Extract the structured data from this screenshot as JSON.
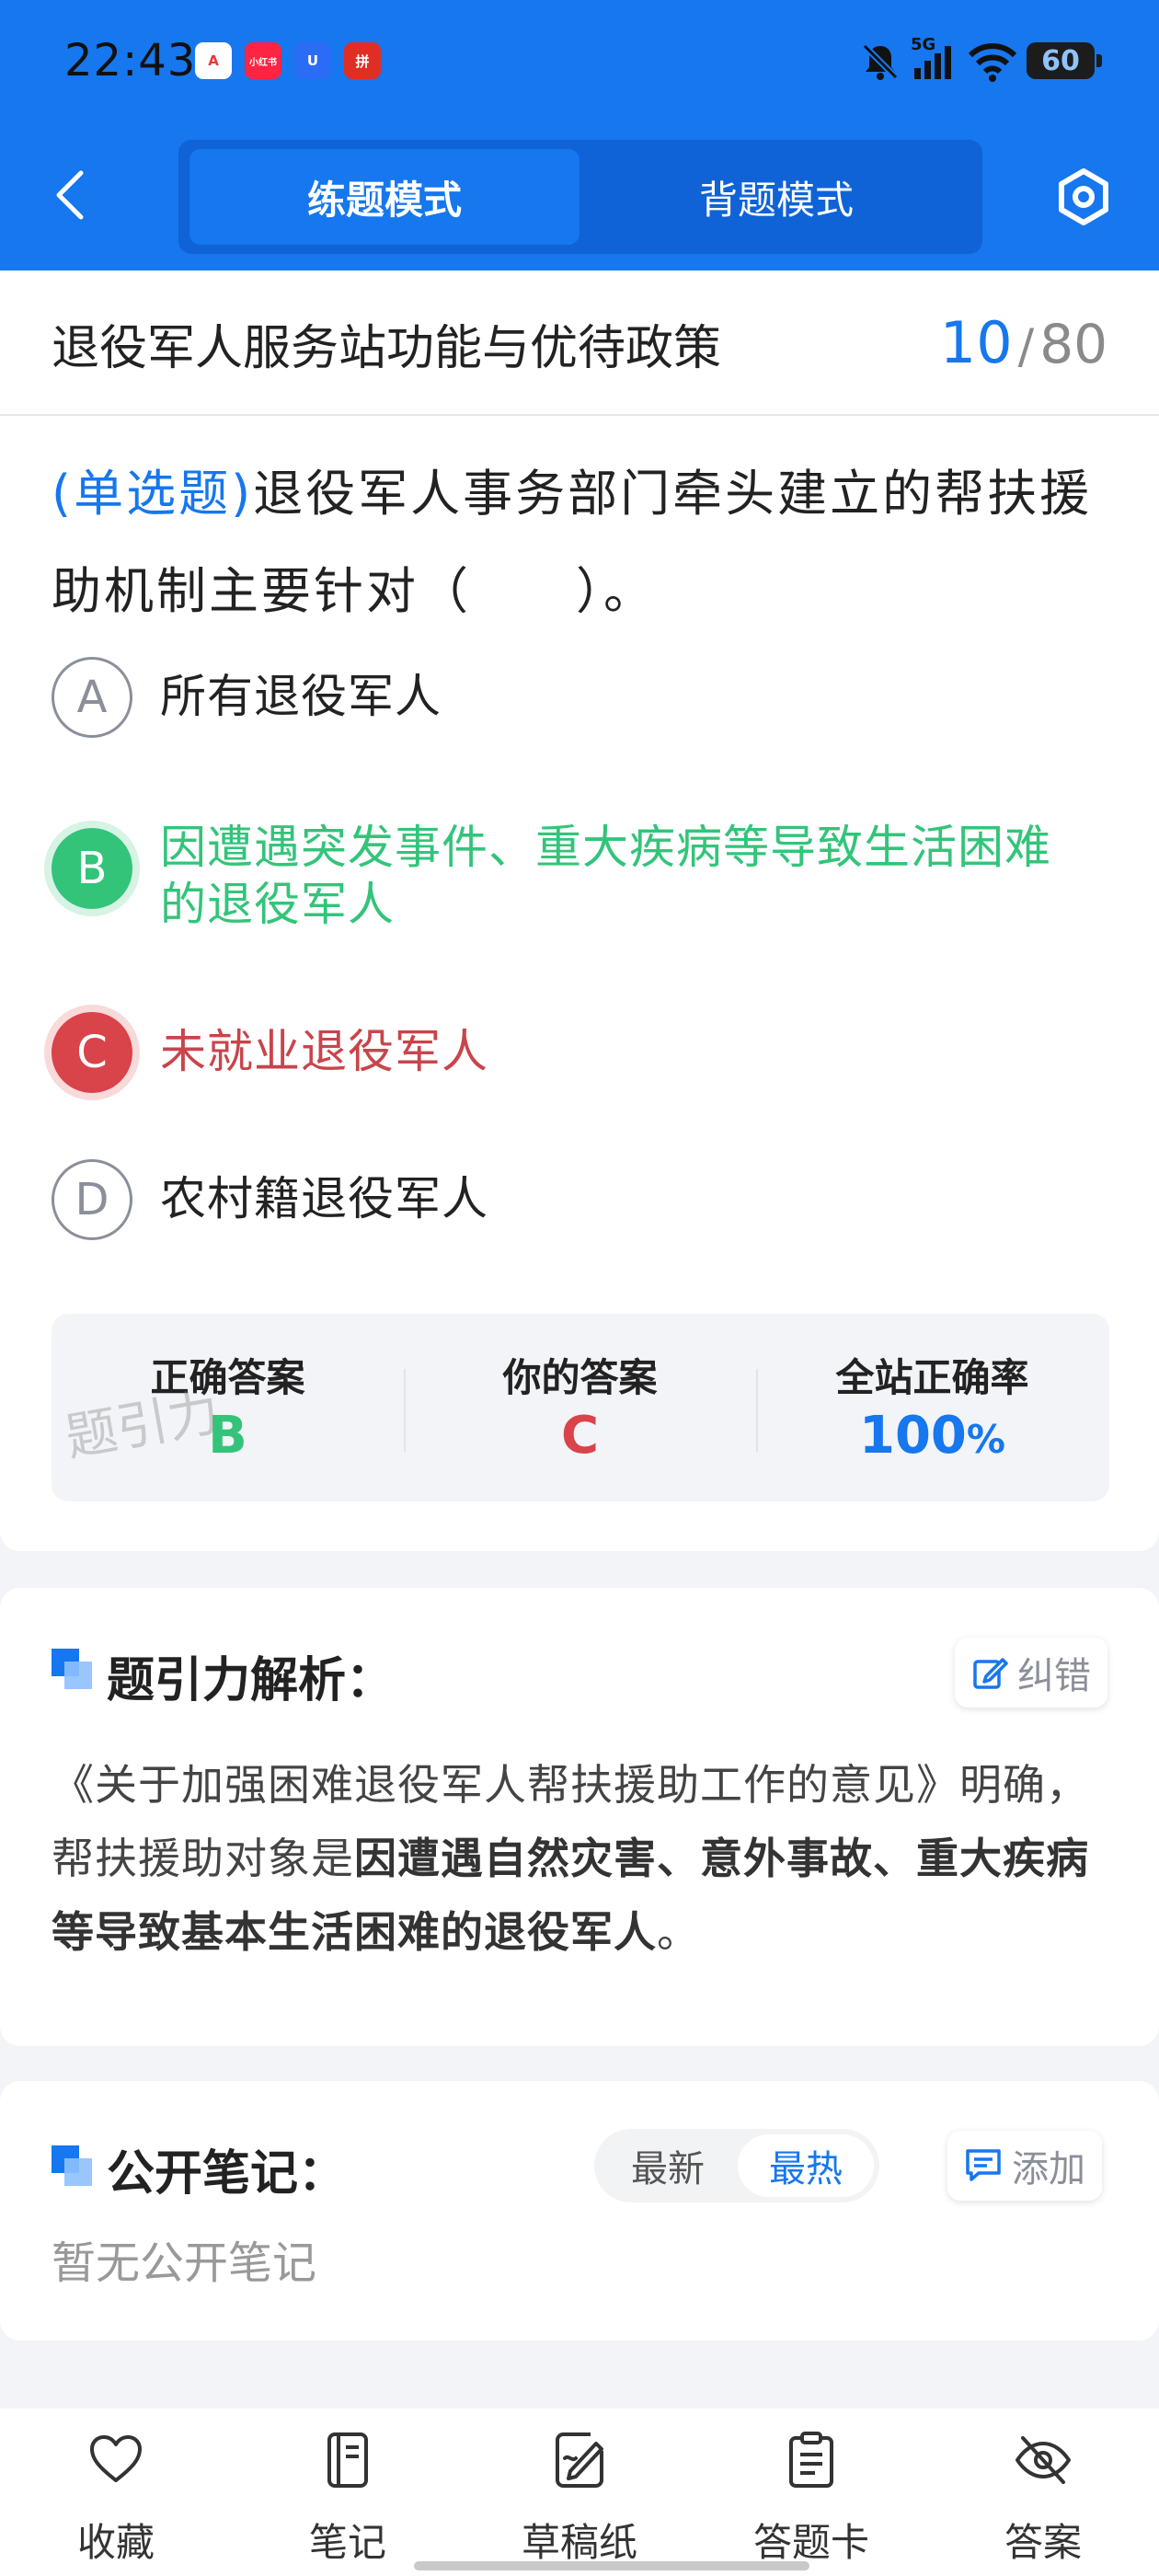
{
  "status_bar": {
    "time": "22:43",
    "network": "5G",
    "battery": "60",
    "app_icons": [
      "app-a-icon",
      "xiaohongshu-icon",
      "u-app-icon",
      "pinduoduo-icon"
    ],
    "app_icon_labels": [
      "A",
      "小红书",
      "U",
      "拼"
    ],
    "app_icon_colors": [
      "#e63a3a",
      "#ff2442",
      "#2a6cf5",
      "#e02e24"
    ]
  },
  "header": {
    "mode_practice": "练题模式",
    "mode_recite": "背题模式",
    "active_mode": "练题模式"
  },
  "question_header": {
    "section_title": "退役军人服务站功能与优待政策",
    "current": "10",
    "separator": "/",
    "total": "80"
  },
  "question": {
    "type": "(单选题)",
    "stem": "退役军人事务部门牵头建立的帮扶援助机制主要针对（　　）。",
    "options": [
      {
        "key": "A",
        "text": "所有退役军人",
        "state": "normal"
      },
      {
        "key": "B",
        "text": "因遭遇突发事件、重大疾病等导致生活困难的退役军人",
        "state": "correct"
      },
      {
        "key": "C",
        "text": "未就业退役军人",
        "state": "wrong"
      },
      {
        "key": "D",
        "text": "农村籍退役军人",
        "state": "normal"
      }
    ]
  },
  "answer_stats": {
    "correct_label": "正确答案",
    "correct_value": "B",
    "yours_label": "你的答案",
    "yours_value": "C",
    "rate_label": "全站正确率",
    "rate_value": "100",
    "rate_unit": "%",
    "watermark": "题引力"
  },
  "explanation": {
    "title": "题引力解析：",
    "report_label": "纠错",
    "text_plain": "《关于加强困难退役军人帮扶援助工作的意见》明确，帮扶援助对象是",
    "text_bold": "因遭遇自然灾害、意外事故、重大疾病等导致基本生活困难的退役军人",
    "text_end": "。"
  },
  "notes": {
    "title": "公开笔记：",
    "sort_latest": "最新",
    "sort_hot": "最热",
    "add_label": "添加",
    "empty_text": "暂无公开笔记"
  },
  "bottom_nav": {
    "items": [
      "收藏",
      "笔记",
      "草稿纸",
      "答题卡",
      "答案"
    ]
  },
  "colors": {
    "brand_blue": "#1677ee",
    "correct_green": "#33c47a",
    "wrong_red": "#d9434a"
  }
}
